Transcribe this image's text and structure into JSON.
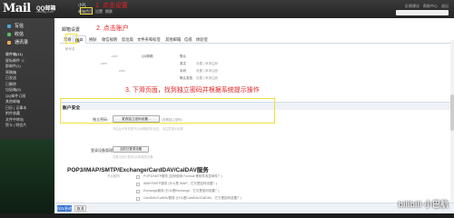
{
  "header": {
    "logo_text": "Mail",
    "logo_cn": "QQ邮箱",
    "logo_sub": "mail.qq.com",
    "user_name": "小礼",
    "links": [
      "邮箱首页",
      "设置",
      "换肤"
    ],
    "right_links": [
      "反馈建议",
      "帮助中心",
      "退出"
    ]
  },
  "sidebar": {
    "main": [
      {
        "label": "写信",
        "color": "#4aa3df"
      },
      {
        "label": "收信",
        "color": "#58c15b"
      },
      {
        "label": "通讯录",
        "color": "#f0ad4e"
      }
    ],
    "folders": [
      {
        "label": "收件箱(11)",
        "hd": true
      },
      {
        "label": "星标邮件 ☆"
      },
      {
        "label": "群邮件(1)"
      },
      {
        "label": "草稿箱"
      },
      {
        "label": "已发送"
      },
      {
        "label": "已删除"
      },
      {
        "label": "垃圾箱(5)"
      },
      {
        "label": "QQ邮件订阅"
      },
      {
        "label": "其他邮箱"
      },
      {
        "label": "日历 | 记事本"
      },
      {
        "label": "附件收藏"
      },
      {
        "label": "文件中转站"
      },
      {
        "label": "贺卡 | 明信片"
      }
    ]
  },
  "content": {
    "title": "邮箱设置",
    "tabs": [
      "常规",
      "账户",
      "换肤",
      "收信规则",
      "反垃圾",
      "文件夹和标签",
      "其他邮箱",
      "信纸",
      "体验室"
    ],
    "active_tab": "账户",
    "info_rows": [
      {
        "a": "帐号名",
        "b": "",
        "c": "",
        "d": "",
        "e": ""
      },
      {
        "a": "",
        "b": ".com",
        "c": "QQ邮箱",
        "d": "默认",
        "e": ""
      },
      {
        "a": "",
        "b": ".com",
        "c": "",
        "d": "英文",
        "e": "设置 | 申请注册"
      },
      {
        "a": "",
        "b": ".com",
        "c": "",
        "d": "手机",
        "e": "设置 | 申请注册"
      },
      {
        "a": "",
        "b": "",
        "c": "",
        "d": "默认发信",
        "e": "设置 | 申请注册"
      }
    ],
    "section_title": "账户安全",
    "password_label": "独立密码:",
    "password_button": "更改独立密码设置...",
    "password_note": "(查看独立密码)",
    "password_desc": "开启后可有效提升QQ邮箱的安全性，请注意提示设置",
    "device_label": "登录设备管理:",
    "device_button": "当前已登录设备",
    "device_note": "查看当前已登录QQ邮箱的设备",
    "pop_title": "POP3/IMAP/SMTP/Exchange/CardDAV/CalDAV服务",
    "pop_rows": [
      {
        "l": "开启服务:",
        "t": "POP3/SMTP服务 (如何使用 Foxmail 等软件收发邮件？)"
      },
      {
        "l": "",
        "t": "IMAP/SMTP服务 (什么是 IMAP，它又是如何设置？)"
      },
      {
        "l": "",
        "t": "Exchange服务 (什么是Exchange，它又是如何设置？)"
      },
      {
        "l": "",
        "t": "CardDAV/CalDAV服务 (什么是CardDAV/CalDAV，它又是如何设置？)"
      },
      {
        "l": "",
        "t": "(POP3/IMAP/SMTP/CardDAV/CalDAV服务均支持SSL连接，如何设置？)"
      }
    ],
    "save_label": "保存更改",
    "cancel_label": "取消"
  },
  "annotations": {
    "step1": "1. 点击设置",
    "step2": "2. 点击账户",
    "step3": "3. 下滑页面，找到独立密码并根据系统提示操作"
  },
  "watermark": "bilibili 小巴航"
}
